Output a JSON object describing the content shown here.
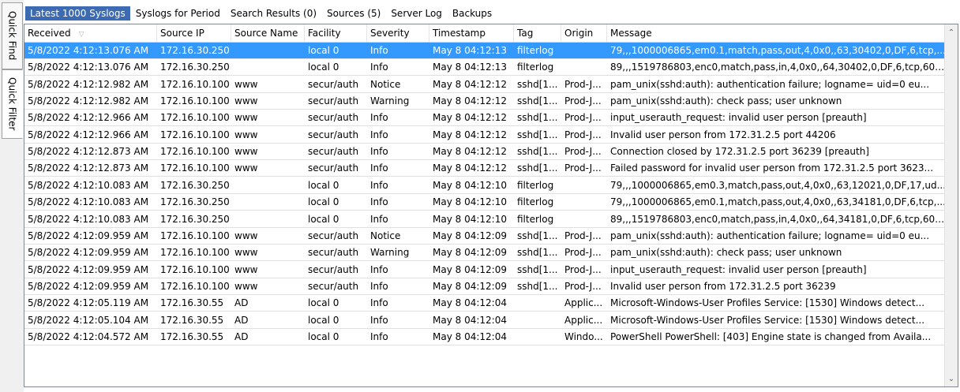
{
  "side_tabs": [
    "Quick Find",
    "Quick Filter"
  ],
  "tabs": [
    "Latest 1000 Syslogs",
    "Syslogs for Period",
    "Search Results (0)",
    "Sources (5)",
    "Server Log",
    "Backups"
  ],
  "columns": [
    "Received",
    "Source IP",
    "Source Name",
    "Facility",
    "Severity",
    "Timestamp",
    "Tag",
    "Origin",
    "Message"
  ],
  "rows": [
    [
      "5/8/2022 4:12:13.076 AM",
      "172.16.30.250",
      "",
      "local 0",
      "Info",
      "May  8 04:12:13",
      "filterlog",
      "",
      "79,,,1000006865,em0.1,match,pass,out,4,0x0,,63,30402,0,DF,6,tcp,..."
    ],
    [
      "5/8/2022 4:12:13.076 AM",
      "172.16.30.250",
      "",
      "local 0",
      "Info",
      "May  8 04:12:13",
      "filterlog",
      "",
      "89,,,1519786803,enc0,match,pass,in,4,0x0,,64,30402,0,DF,6,tcp,60,..."
    ],
    [
      "5/8/2022 4:12:12.982 AM",
      "172.16.10.100",
      "www",
      "secur/auth",
      "Notice",
      "May  8 04:12:12",
      "sshd[1...",
      "Prod-J...",
      "pam_unix(sshd:auth): authentication failure; logname= uid=0 eu..."
    ],
    [
      "5/8/2022 4:12:12.982 AM",
      "172.16.10.100",
      "www",
      "secur/auth",
      "Warning",
      "May  8 04:12:12",
      "sshd[1...",
      "Prod-J...",
      "pam_unix(sshd:auth): check pass; user unknown"
    ],
    [
      "5/8/2022 4:12:12.966 AM",
      "172.16.10.100",
      "www",
      "secur/auth",
      "Info",
      "May  8 04:12:12",
      "sshd[1...",
      "Prod-J...",
      "input_userauth_request: invalid user person [preauth]"
    ],
    [
      "5/8/2022 4:12:12.966 AM",
      "172.16.10.100",
      "www",
      "secur/auth",
      "Info",
      "May  8 04:12:12",
      "sshd[1...",
      "Prod-J...",
      "Invalid user person from 172.31.2.5 port 44206"
    ],
    [
      "5/8/2022 4:12:12.873 AM",
      "172.16.10.100",
      "www",
      "secur/auth",
      "Info",
      "May  8 04:12:12",
      "sshd[1...",
      "Prod-J...",
      "Connection closed by 172.31.2.5 port 36239 [preauth]"
    ],
    [
      "5/8/2022 4:12:12.873 AM",
      "172.16.10.100",
      "www",
      "secur/auth",
      "Info",
      "May  8 04:12:12",
      "sshd[1...",
      "Prod-J...",
      "Failed password for invalid user person from 172.31.2.5 port 3623..."
    ],
    [
      "5/8/2022 4:12:10.083 AM",
      "172.16.30.250",
      "",
      "local 0",
      "Info",
      "May  8 04:12:10",
      "filterlog",
      "",
      "79,,,1000006865,em0.3,match,pass,out,4,0x0,,63,12021,0,DF,17,ud..."
    ],
    [
      "5/8/2022 4:12:10.083 AM",
      "172.16.30.250",
      "",
      "local 0",
      "Info",
      "May  8 04:12:10",
      "filterlog",
      "",
      "79,,,1000006865,em0.1,match,pass,out,4,0x0,,63,34181,0,DF,6,tcp,..."
    ],
    [
      "5/8/2022 4:12:10.083 AM",
      "172.16.30.250",
      "",
      "local 0",
      "Info",
      "May  8 04:12:10",
      "filterlog",
      "",
      "89,,,1519786803,enc0,match,pass,in,4,0x0,,64,34181,0,DF,6,tcp,60,..."
    ],
    [
      "5/8/2022 4:12:09.959 AM",
      "172.16.10.100",
      "www",
      "secur/auth",
      "Notice",
      "May  8 04:12:09",
      "sshd[1...",
      "Prod-J...",
      "pam_unix(sshd:auth): authentication failure; logname= uid=0 eu..."
    ],
    [
      "5/8/2022 4:12:09.959 AM",
      "172.16.10.100",
      "www",
      "secur/auth",
      "Warning",
      "May  8 04:12:09",
      "sshd[1...",
      "Prod-J...",
      "pam_unix(sshd:auth): check pass; user unknown"
    ],
    [
      "5/8/2022 4:12:09.959 AM",
      "172.16.10.100",
      "www",
      "secur/auth",
      "Info",
      "May  8 04:12:09",
      "sshd[1...",
      "Prod-J...",
      "input_userauth_request: invalid user person [preauth]"
    ],
    [
      "5/8/2022 4:12:09.959 AM",
      "172.16.10.100",
      "www",
      "secur/auth",
      "Info",
      "May  8 04:12:09",
      "sshd[1...",
      "Prod-J...",
      "Invalid user person from 172.31.2.5 port 36239"
    ],
    [
      "5/8/2022 4:12:05.119 AM",
      "172.16.30.55",
      "AD",
      "local 0",
      "Info",
      "May  8 04:12:04",
      "",
      "Applic...",
      "Microsoft-Windows-User Profiles Service: [1530] Windows detect..."
    ],
    [
      "5/8/2022 4:12:05.104 AM",
      "172.16.30.55",
      "AD",
      "local 0",
      "Info",
      "May  8 04:12:04",
      "",
      "Applic...",
      "Microsoft-Windows-User Profiles Service: [1530] Windows detect..."
    ],
    [
      "5/8/2022 4:12:04.572 AM",
      "172.16.30.55",
      "AD",
      "local 0",
      "Info",
      "May  8 04:12:04",
      "",
      "Windo...",
      "PowerShell PowerShell: [403] Engine state is changed from Availa..."
    ]
  ],
  "selected_row": 0,
  "icons": {
    "sort": "sort-desc-arrow",
    "scroll_up": "chevron-up",
    "scroll_down": "chevron-down"
  },
  "colors": {
    "selection": "#3399ff",
    "active_tab": "#3d6bb3"
  }
}
